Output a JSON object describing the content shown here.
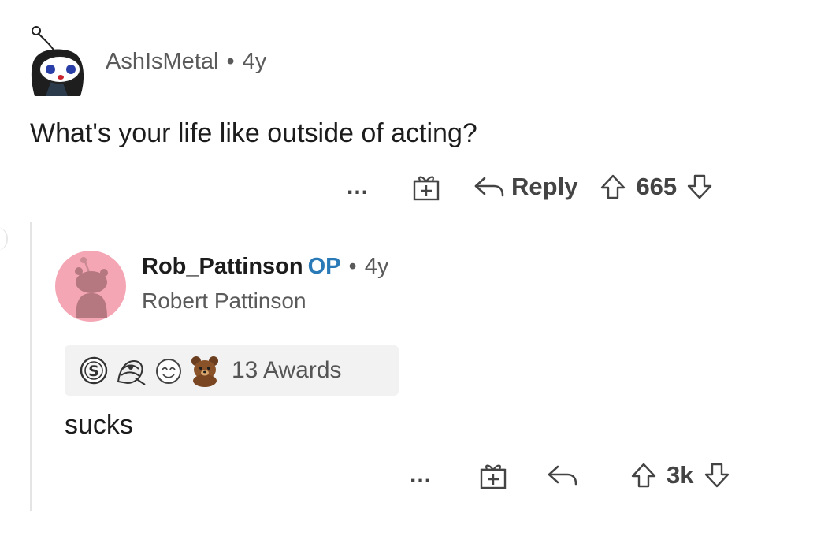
{
  "comment": {
    "author": "AshIsMetal",
    "separator": "•",
    "age": "4y",
    "body": "What's your life like outside of acting?",
    "actions": {
      "more_label": "...",
      "gift_icon": "gift-add-icon",
      "reply_label": "Reply",
      "score": "665"
    }
  },
  "reply": {
    "author": "Rob_Pattinson",
    "op_badge": "OP",
    "separator": "•",
    "age": "4y",
    "flair": "Robert Pattinson",
    "awards": {
      "icons": [
        "silver-award-icon",
        "hugz-award-icon",
        "wholesome-award-icon",
        "bear-award-icon"
      ],
      "count_label": "13 Awards"
    },
    "body": "sucks",
    "actions": {
      "more_label": "...",
      "gift_icon": "gift-add-icon",
      "score": "3k"
    }
  },
  "colors": {
    "op_badge": "#2a7ab8",
    "meta_text": "#5a5a5a",
    "avatar_bg": "#f4a6b4",
    "award_bar_bg": "#f2f2f2"
  }
}
